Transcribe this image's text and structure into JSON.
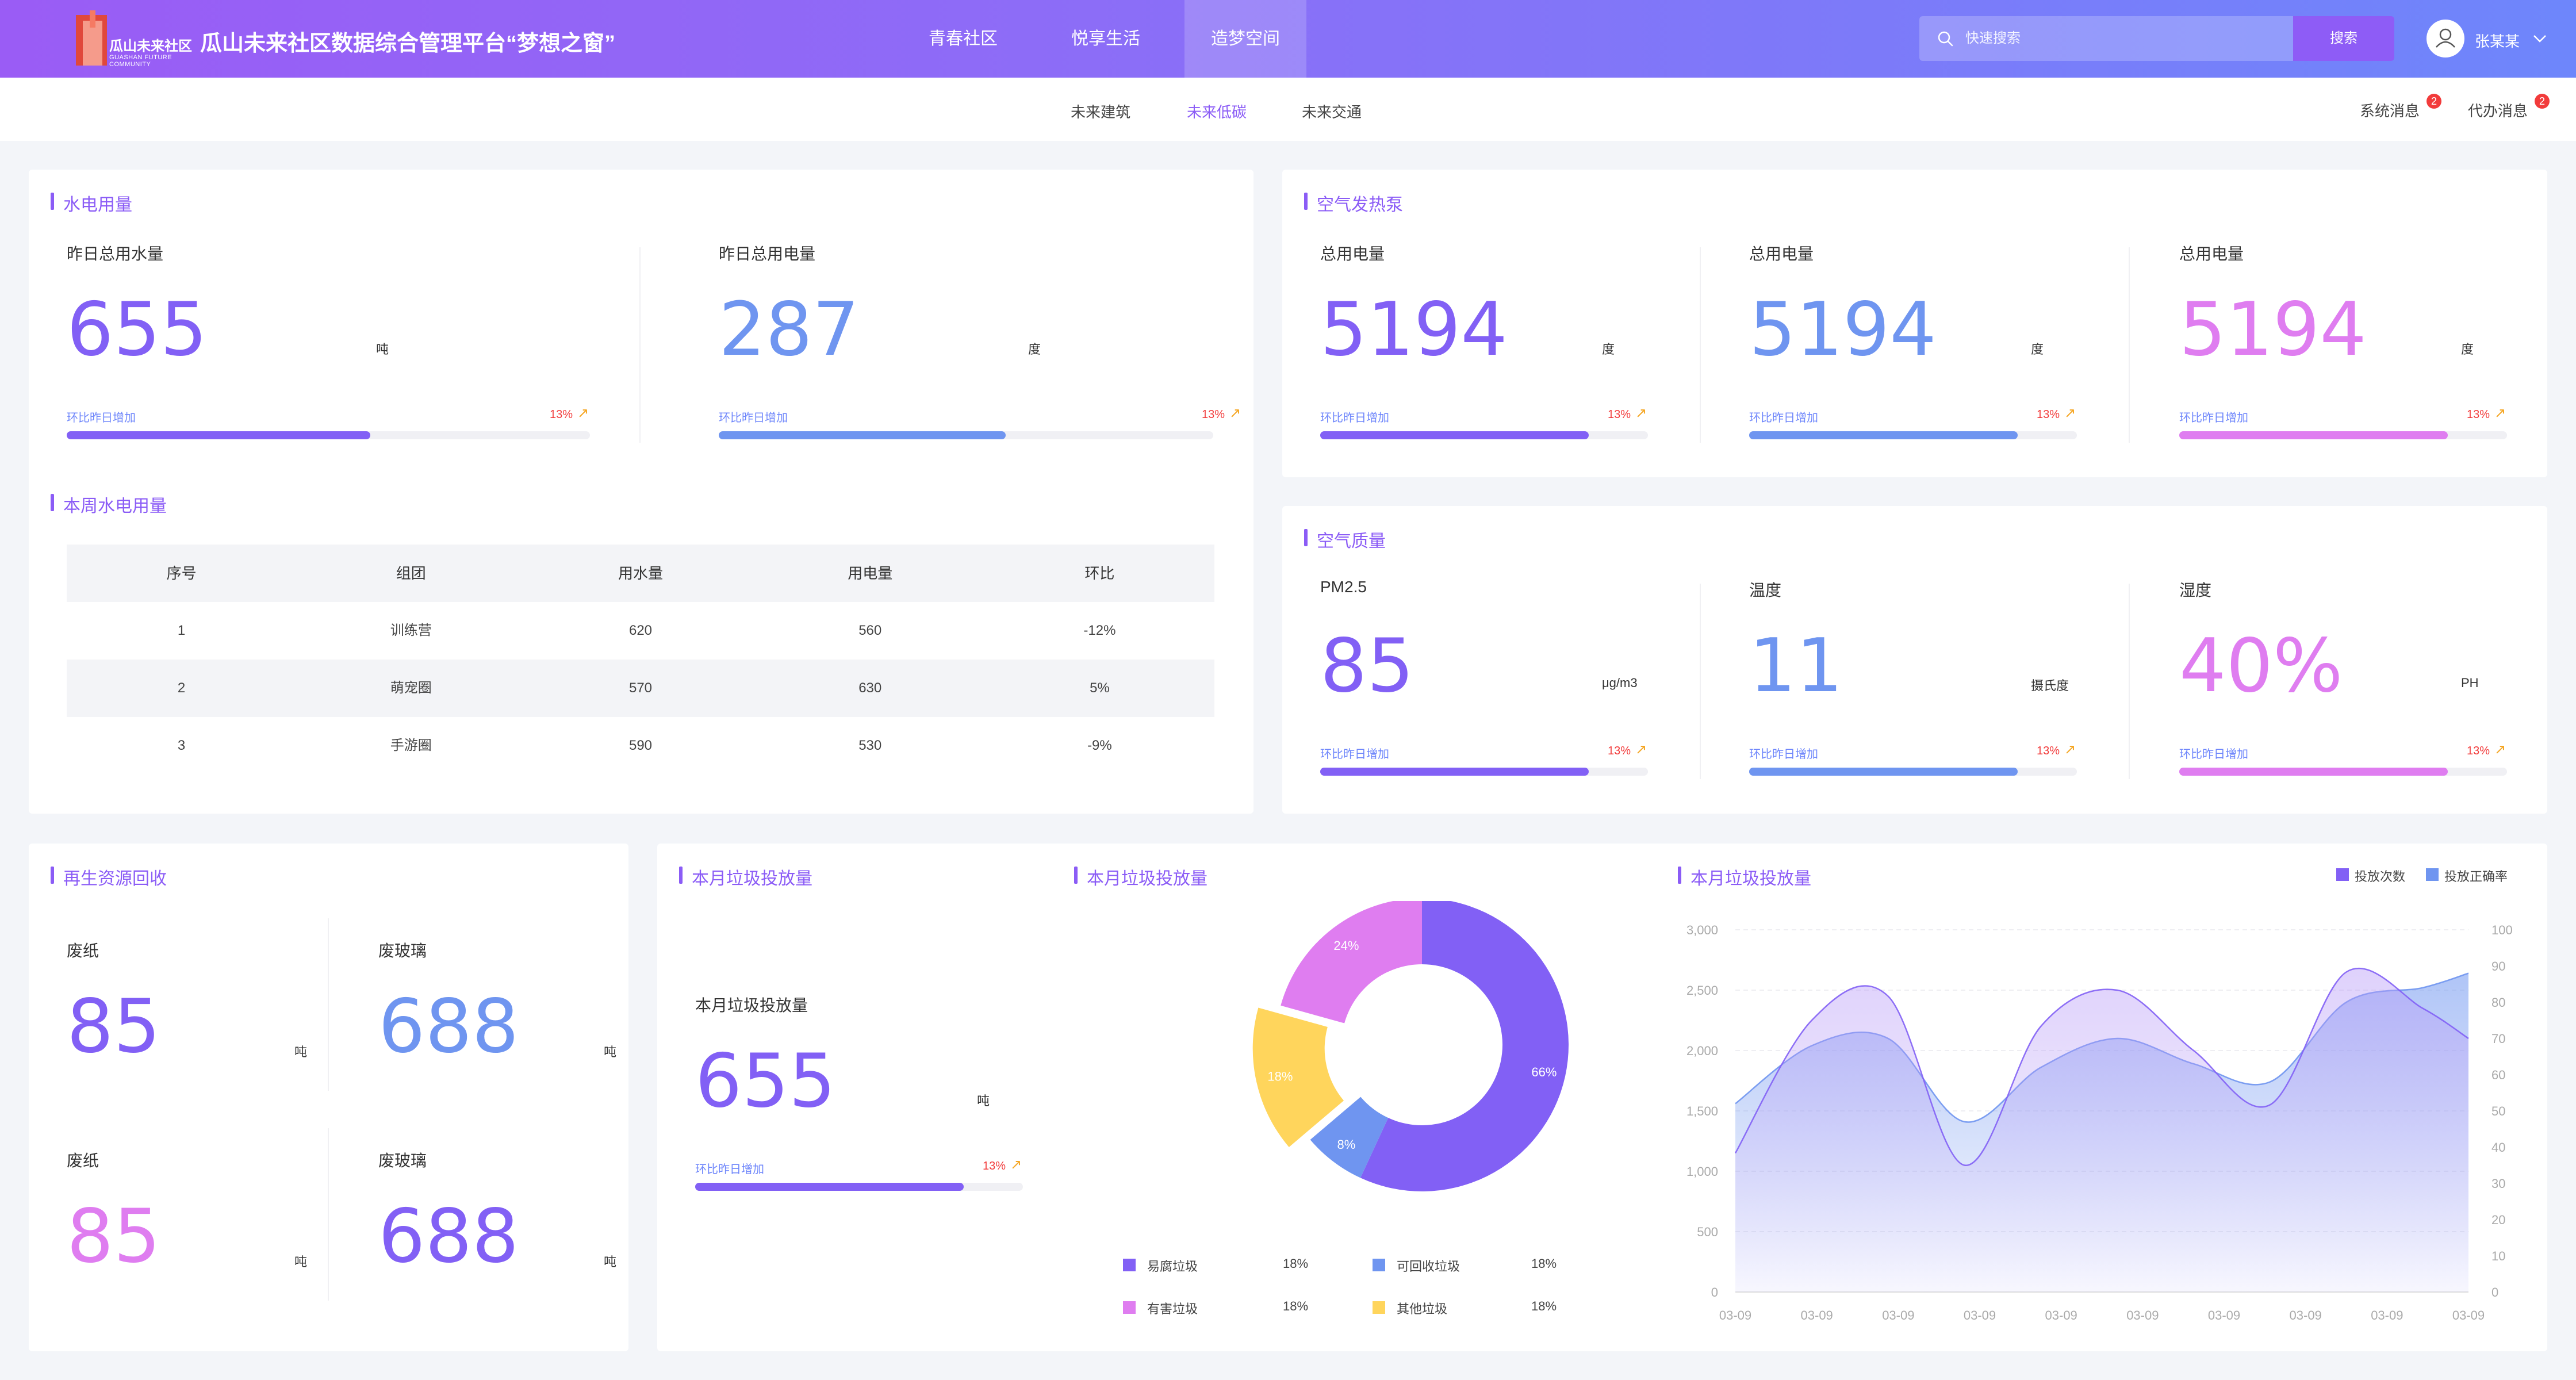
{
  "header": {
    "logo": {
      "title": "瓜山未来社区",
      "subtitle": "GUASHAN FUTURE COMMUNITY"
    },
    "app_title": "瓜山未来社区数据综合管理平台“梦想之窗”",
    "tabs": [
      {
        "label": "青春社区",
        "active": false
      },
      {
        "label": "悦享生活",
        "active": false
      },
      {
        "label": "造梦空间",
        "active": true
      }
    ],
    "search": {
      "placeholder": "快速搜索",
      "button": "搜索"
    },
    "user": {
      "name": "张某某"
    }
  },
  "subnav": {
    "tabs": [
      {
        "label": "未来建筑",
        "active": false
      },
      {
        "label": "未来低碳",
        "active": true
      },
      {
        "label": "未来交通",
        "active": false
      }
    ],
    "messages": [
      {
        "label": "系统消息",
        "count": "2"
      },
      {
        "label": "代办消息",
        "count": "2"
      }
    ]
  },
  "water_power": {
    "title": "水电用量",
    "metrics": [
      {
        "label": "昨日总用水量",
        "value": "655",
        "unit": "吨",
        "compare": "环比昨日增加",
        "pct": "13%",
        "fill": 0.58
      },
      {
        "label": "昨日总用电量",
        "value": "287",
        "unit": "度",
        "compare": "环比昨日增加",
        "pct": "13%",
        "fill": 0.58
      }
    ]
  },
  "weekly": {
    "title": "本周水电用量",
    "headers": [
      "序号",
      "组团",
      "用水量",
      "用电量",
      "环比"
    ],
    "rows": [
      [
        "1",
        "训练营",
        "620",
        "560",
        "-12%"
      ],
      [
        "2",
        "萌宠圈",
        "570",
        "630",
        "5%"
      ],
      [
        "3",
        "手游圈",
        "590",
        "530",
        "-9%"
      ]
    ]
  },
  "heat_pump": {
    "title": "空气发热泵",
    "metrics": [
      {
        "label": "总用电量",
        "value": "5194",
        "unit": "度",
        "compare": "环比昨日增加",
        "pct": "13%",
        "fill": 0.82
      },
      {
        "label": "总用电量",
        "value": "5194",
        "unit": "度",
        "compare": "环比昨日增加",
        "pct": "13%",
        "fill": 0.82
      },
      {
        "label": "总用电量",
        "value": "5194",
        "unit": "度",
        "compare": "环比昨日增加",
        "pct": "13%",
        "fill": 0.82
      }
    ]
  },
  "air_quality": {
    "title": "空气质量",
    "metrics": [
      {
        "label": "PM2.5",
        "value": "85",
        "unit": "μg/m3",
        "compare": "环比昨日增加",
        "pct": "13%",
        "fill": 0.82
      },
      {
        "label": "温度",
        "value": "11",
        "unit": "摄氏度",
        "compare": "环比昨日增加",
        "pct": "13%",
        "fill": 0.82
      },
      {
        "label": "湿度",
        "value": "40%",
        "unit": "PH",
        "compare": "环比昨日增加",
        "pct": "13%",
        "fill": 0.82
      }
    ]
  },
  "recycle": {
    "title": "再生资源回收",
    "items": [
      {
        "label": "废纸",
        "value": "85",
        "unit": "吨",
        "color": "#8260f5"
      },
      {
        "label": "废玻璃",
        "value": "688",
        "unit": "吨",
        "color": "#6f95f0"
      },
      {
        "label": "废纸",
        "value": "85",
        "unit": "吨",
        "color": "#df7df0"
      },
      {
        "label": "废玻璃",
        "value": "688",
        "unit": "吨",
        "color": "#8260f5"
      }
    ]
  },
  "garbage_total": {
    "title": "本月垃圾投放量",
    "label": "本月垃圾投放量",
    "value": "655",
    "unit": "吨",
    "compare": "环比昨日增加",
    "pct": "13%",
    "fill": 0.82
  },
  "garbage_pie": {
    "title": "本月垃圾投放量",
    "legend": [
      {
        "name": "易腐垃圾",
        "value": "18%",
        "color": "#8260f5"
      },
      {
        "name": "可回收垃圾",
        "value": "18%",
        "color": "#6f95f0"
      },
      {
        "name": "有害垃圾",
        "value": "18%",
        "color": "#df7df0"
      },
      {
        "name": "其他垃圾",
        "value": "18%",
        "color": "#ffd55c"
      }
    ]
  },
  "chart_data": [
    {
      "type": "pie",
      "title": "",
      "donut": true,
      "slices": [
        {
          "label": "66%",
          "value": 66,
          "color": "#8260f5"
        },
        {
          "label": "8%",
          "value": 8,
          "color": "#6f95f0"
        },
        {
          "label": "18%",
          "value": 18,
          "color": "#ffd55c",
          "exploded": true
        },
        {
          "label": "24%",
          "value": 24,
          "color": "#df7df0"
        }
      ]
    },
    {
      "type": "area",
      "title": "本月垃圾投放量",
      "categories": [
        "03-09",
        "03-09",
        "03-09",
        "03-09",
        "03-09",
        "03-09",
        "03-09",
        "03-09",
        "03-09",
        "03-09"
      ],
      "ylim_left": [
        0,
        3000
      ],
      "yticks_left": [
        "0",
        "500",
        "1,000",
        "1,500",
        "2,000",
        "2,500",
        "3,000"
      ],
      "ylim_right": [
        0,
        100
      ],
      "yticks_right": [
        "0",
        "10",
        "20",
        "30",
        "40",
        "50",
        "60",
        "70",
        "80",
        "90",
        "100"
      ],
      "legend_position": "top-right",
      "series": [
        {
          "name": "投放次数",
          "axis": "left",
          "color": "#8260f5",
          "x": [
            0,
            1,
            2,
            3,
            4,
            5,
            6,
            7,
            8,
            9,
            9.6
          ],
          "values": [
            1150,
            2250,
            2450,
            1050,
            2200,
            2500,
            2000,
            1550,
            2650,
            2350,
            2100
          ]
        },
        {
          "name": "投放正确率",
          "axis": "right",
          "color": "#6f95f0",
          "x": [
            0,
            1,
            2,
            3,
            4,
            5,
            6,
            7,
            8,
            9,
            9.6
          ],
          "values": [
            52,
            68,
            70,
            47,
            62,
            70,
            63,
            58,
            80,
            84,
            88
          ]
        }
      ]
    }
  ]
}
